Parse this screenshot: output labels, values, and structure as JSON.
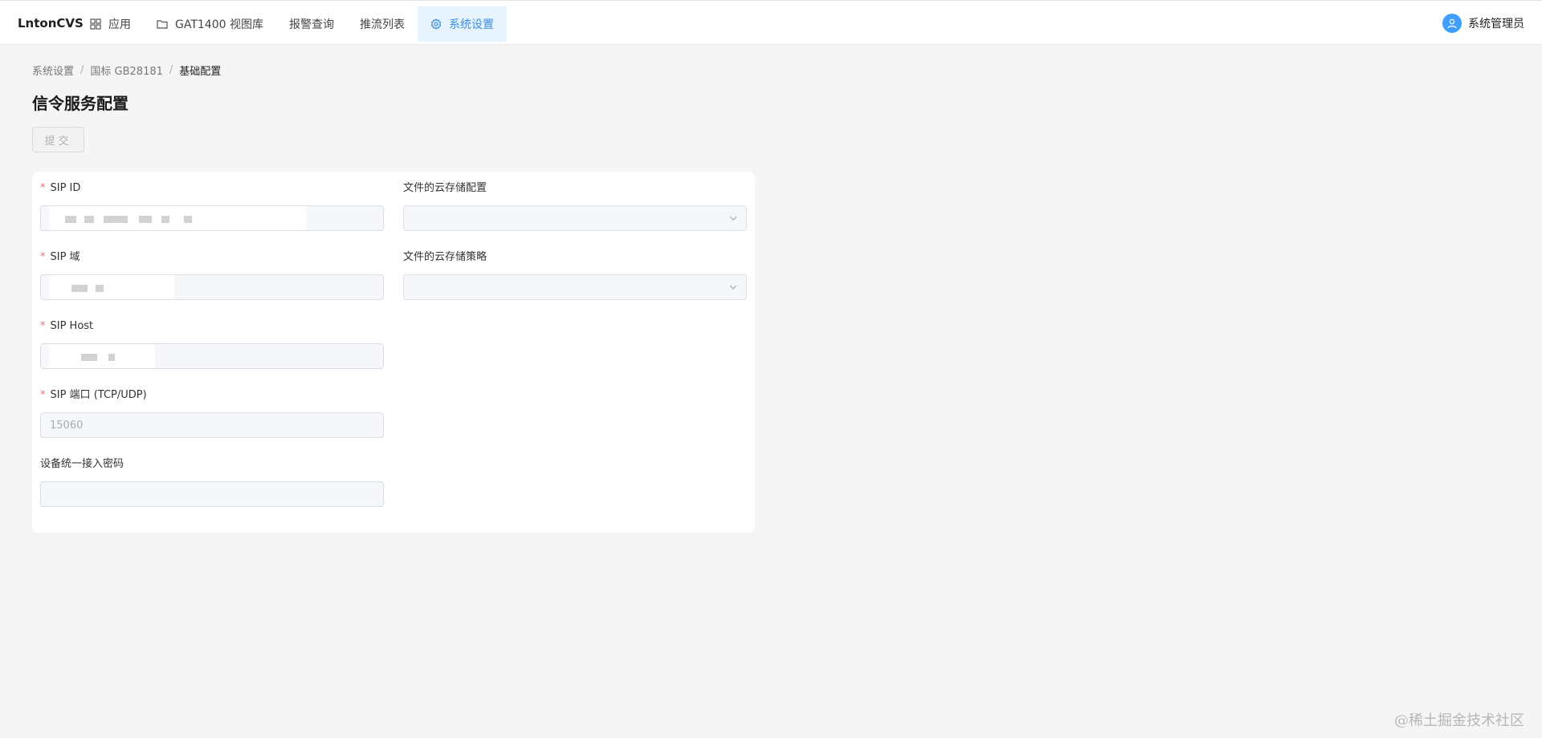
{
  "app": {
    "brand": "LntonCVS"
  },
  "nav": {
    "items": [
      {
        "label": "应用",
        "icon": "grid-icon"
      },
      {
        "label": "GAT1400 视图库",
        "icon": "folder-icon"
      },
      {
        "label": "报警查询",
        "icon": ""
      },
      {
        "label": "推流列表",
        "icon": ""
      },
      {
        "label": "系统设置",
        "icon": "gear-icon",
        "active": true
      }
    ]
  },
  "user": {
    "name": "系统管理员",
    "icon": "user-icon"
  },
  "breadcrumb": {
    "item1": "系统设置",
    "sep": "/",
    "item2": "国标 GB28181",
    "current": "基础配置"
  },
  "page": {
    "title": "信令服务配置"
  },
  "toolbar": {
    "submit_label": "提交"
  },
  "form": {
    "required_mark": "*",
    "sip_id": {
      "label": "SIP ID",
      "value": ""
    },
    "sip_domain": {
      "label": "SIP 域",
      "value": ""
    },
    "sip_host": {
      "label": "SIP Host",
      "value": ""
    },
    "sip_port": {
      "label": "SIP 端口 (TCP/UDP)",
      "value": "15060"
    },
    "device_password": {
      "label": "设备统一接入密码",
      "value": ""
    },
    "cloud_storage_config": {
      "label": "文件的云存储配置",
      "value": ""
    },
    "cloud_storage_policy": {
      "label": "文件的云存储策略",
      "value": ""
    }
  },
  "watermark": "@稀土掘金技术社区",
  "colors": {
    "accent": "#409eff",
    "active_bg": "#e8f4fd",
    "required": "#f56c6c"
  }
}
